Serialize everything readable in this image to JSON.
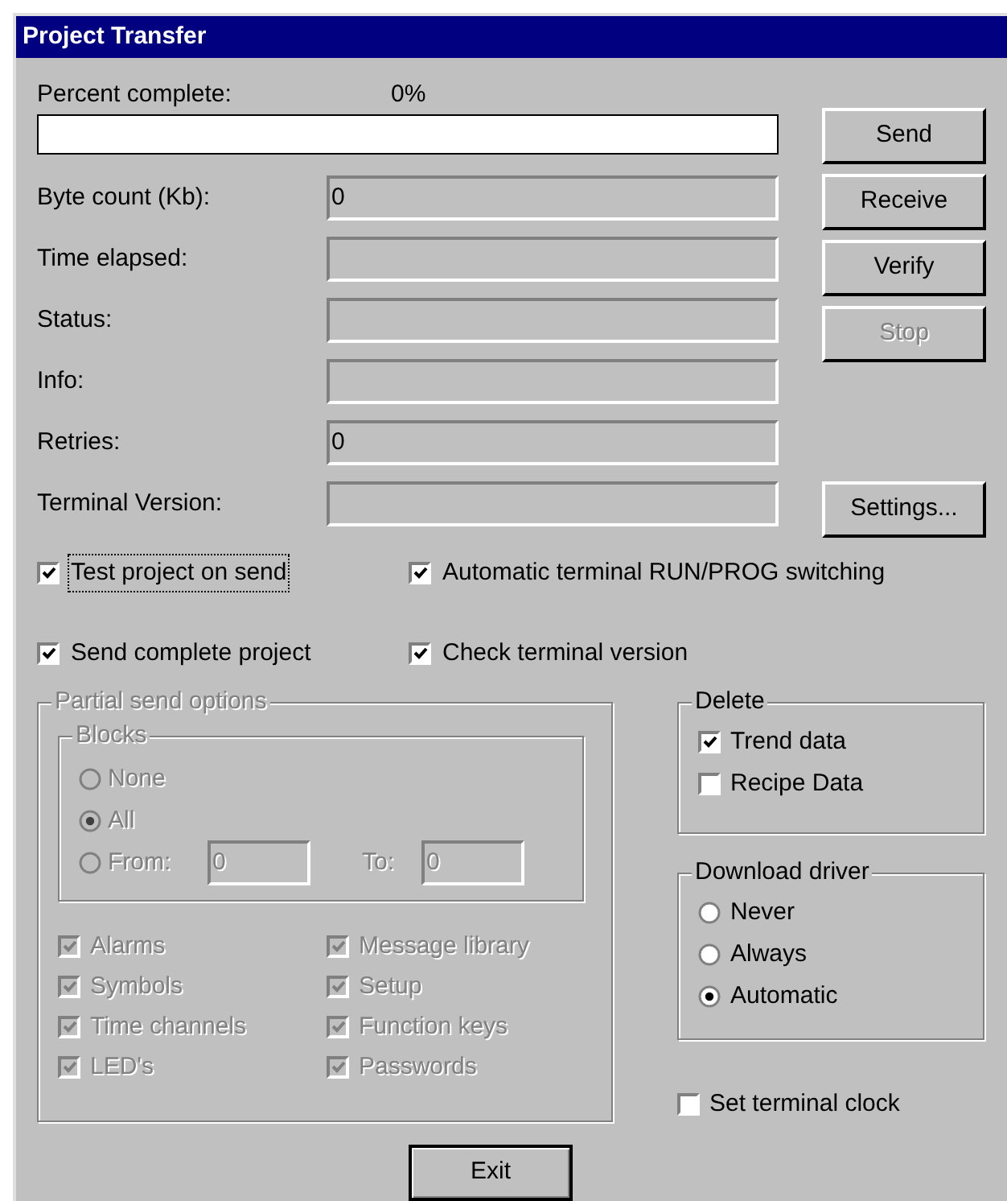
{
  "window": {
    "title": "Project Transfer"
  },
  "progress": {
    "label": "Percent complete:",
    "reading": "0%",
    "level": 0
  },
  "fields": [
    {
      "label": "Byte count (Kb):",
      "value": "0"
    },
    {
      "label": "Time elapsed:"
    },
    {
      "label": "Status:"
    },
    {
      "label": "Info:"
    },
    {
      "label": "Retries:",
      "value": "0"
    },
    {
      "label": "Terminal Version:"
    }
  ],
  "action_buttons": [
    {
      "label": "Send",
      "disabled": false
    },
    {
      "label": "Receive",
      "disabled": false
    },
    {
      "label": "Verify",
      "disabled": false
    },
    {
      "label": "Stop",
      "disabled": true
    }
  ],
  "settings_button": {
    "label": "Settings...",
    "disabled": false
  },
  "options": [
    {
      "label": "Test project on send",
      "checked": true,
      "focused": true
    },
    {
      "label": "Automatic terminal RUN/PROG switching",
      "checked": true,
      "focused": false
    },
    {
      "label": "Send complete project",
      "checked": true,
      "focused": false
    },
    {
      "label": "Check terminal version",
      "checked": true,
      "focused": false
    }
  ],
  "partial_send": {
    "title": "Partial send options",
    "disabled": true,
    "blocks": {
      "title": "Blocks",
      "options": [
        {
          "label": "None",
          "selected": false
        },
        {
          "label": "All",
          "selected": true
        },
        {
          "label": "From:",
          "selected": false,
          "value": "0"
        }
      ],
      "to": {
        "label": "To:",
        "value": "0"
      }
    },
    "items": [
      {
        "label": "Alarms",
        "checked": true
      },
      {
        "label": "Message library",
        "checked": true
      },
      {
        "label": "Symbols",
        "checked": true
      },
      {
        "label": "Setup",
        "checked": true
      },
      {
        "label": "Time channels",
        "checked": true
      },
      {
        "label": "Function keys",
        "checked": true
      },
      {
        "label": "LED's",
        "checked": true
      },
      {
        "label": "Passwords",
        "checked": true
      }
    ]
  },
  "delete": {
    "title": "Delete",
    "items": [
      {
        "label": "Trend data",
        "checked": true
      },
      {
        "label": "Recipe Data",
        "checked": false
      }
    ]
  },
  "download_driver": {
    "title": "Download driver",
    "options": [
      {
        "label": "Never",
        "selected": false
      },
      {
        "label": "Always",
        "selected": false
      },
      {
        "label": "Automatic",
        "selected": true
      }
    ]
  },
  "set_terminal_clock": {
    "label": "Set terminal clock",
    "checked": false
  },
  "exit_button": {
    "label": "Exit"
  }
}
